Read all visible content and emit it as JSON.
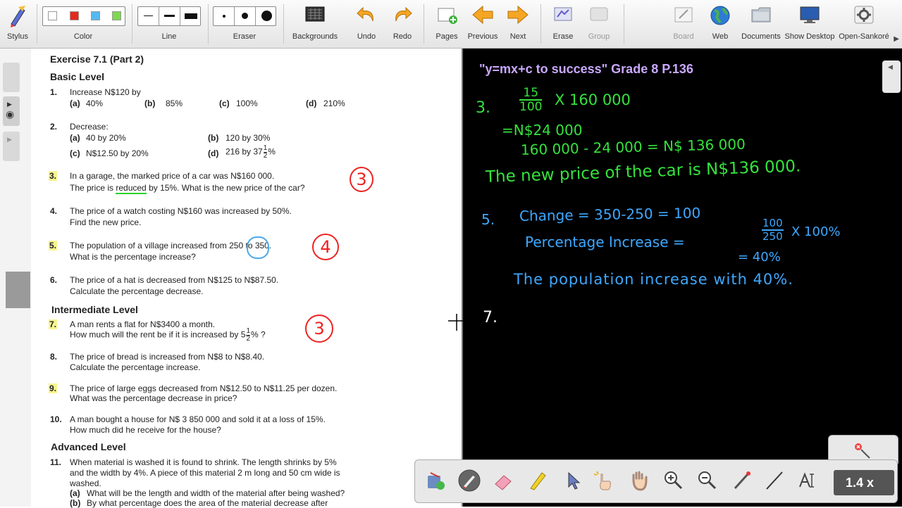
{
  "toolbar": {
    "stylus": "Stylus",
    "color": "Color",
    "line": "Line",
    "eraser": "Eraser",
    "backgrounds": "Backgrounds",
    "undo": "Undo",
    "redo": "Redo",
    "pages": "Pages",
    "previous": "Previous",
    "next": "Next",
    "erase": "Erase",
    "group": "Group",
    "board": "Board",
    "web": "Web",
    "documents": "Documents",
    "show_desktop": "Show Desktop",
    "open_sankore": "Open-Sankoré",
    "swatch_colors": [
      "#ffffff",
      "#e8261b",
      "#57b8f0",
      "#7ed84f"
    ]
  },
  "doc": {
    "title": "Exercise 7.1  (Part 2)",
    "basic": "Basic Level",
    "q1_num": "1.",
    "q1_text": "Increase N$120 by",
    "q1_a_l": "(a)",
    "q1_a": "40%",
    "q1_b_l": "(b)",
    "q1_b": "85%",
    "q1_c_l": "(c)",
    "q1_c": "100%",
    "q1_d_l": "(d)",
    "q1_d": "210%",
    "q2_num": "2.",
    "q2_text": "Decrease:",
    "q2_a_l": "(a)",
    "q2_a": "40 by 20%",
    "q2_b_l": "(b)",
    "q2_b": "120 by 30%",
    "q2_c_l": "(c)",
    "q2_c": "N$12.50 by 20%",
    "q2_d_l": "(d)",
    "q2_d": "216 by 37",
    "q2_d_num": "1",
    "q2_d_den": "2",
    "q2_d_pct": "%",
    "q3_num": "3.",
    "q3_line1": "In a garage, the marked price of a car was N$160 000.",
    "q3_line2a": "The price is ",
    "q3_line2b": "reduced",
    "q3_line2c": " by 15%.  What is the new price of the car?",
    "q4_num": "4.",
    "q4_line1": "The price of a watch costing N$160 was increased by 50%.",
    "q4_line2": "Find the new price.",
    "q5_num": "5.",
    "q5_line1": "The population of a village increased from 250 to 350.",
    "q5_line2": "What is the percentage increase?",
    "q6_num": "6.",
    "q6_line1": "The price of a hat is decreased from N$125 to N$87.50.",
    "q6_line2": "Calculate the percentage decrease.",
    "intermediate": "Intermediate Level",
    "q7_num": "7.",
    "q7_line1": "A man rents a flat for N$3400 a month.",
    "q7_line2a": "How much will the rent be if it is increased by 5",
    "q7_num_f": "1",
    "q7_den_f": "2",
    "q7_line2b": "% ?",
    "q8_num": "8.",
    "q8_line1": "The price of bread is increased from N$8 to N$8.40.",
    "q8_line2": "Calculate the percentage increase.",
    "q9_num": "9.",
    "q9_line1": "The price of large eggs decreased from N$12.50 to N$11.25 per dozen.",
    "q9_line2": "What was the percentage decrease in price?",
    "q10_num": "10.",
    "q10_line1": "A man bought a house for N$ 3 850 000 and sold it at a loss of 15%.",
    "q10_line2": "How much did he receive for the house?",
    "advanced": "Advanced Level",
    "q11_num": "11.",
    "q11_line1": "When material is washed it is found to shrink.  The length shrinks by 5%",
    "q11_line2": "and the width by 4%.  A piece of this material 2 m long and 50 cm wide is",
    "q11_line3": "washed.",
    "q11_a_l": "(a)",
    "q11_a": "What will be the length and width of the material after being washed?",
    "q11_b_l": "(b)",
    "q11_b": "By what percentage does the area of the material decrease after",
    "mark_q3": "3",
    "mark_q5": "4",
    "mark_q7": "3"
  },
  "board": {
    "title": "\"y=mx+c to success\"   Grade 8   P.136",
    "s3_num": "3.",
    "s3_frac_num": "15",
    "s3_frac_den": "100",
    "s3_times": "X  160 000",
    "s3_line2": "=N$24 000",
    "s3_line3": "160 000 - 24 000 = N$ 136 000",
    "s3_line4": "The new price of the car is N$136 000.",
    "s5_num": "5.",
    "s5_line1": "Change  = 350-250 = 100",
    "s5_line2a": "Percentage Increase  =",
    "s5_frac_num": "100",
    "s5_frac_den": "250",
    "s5_line2b": "X 100%",
    "s5_line3": "= 40%",
    "s5_line4": "The population increase with 40%.",
    "s7_num": "7."
  },
  "zoom": "1.4 x"
}
